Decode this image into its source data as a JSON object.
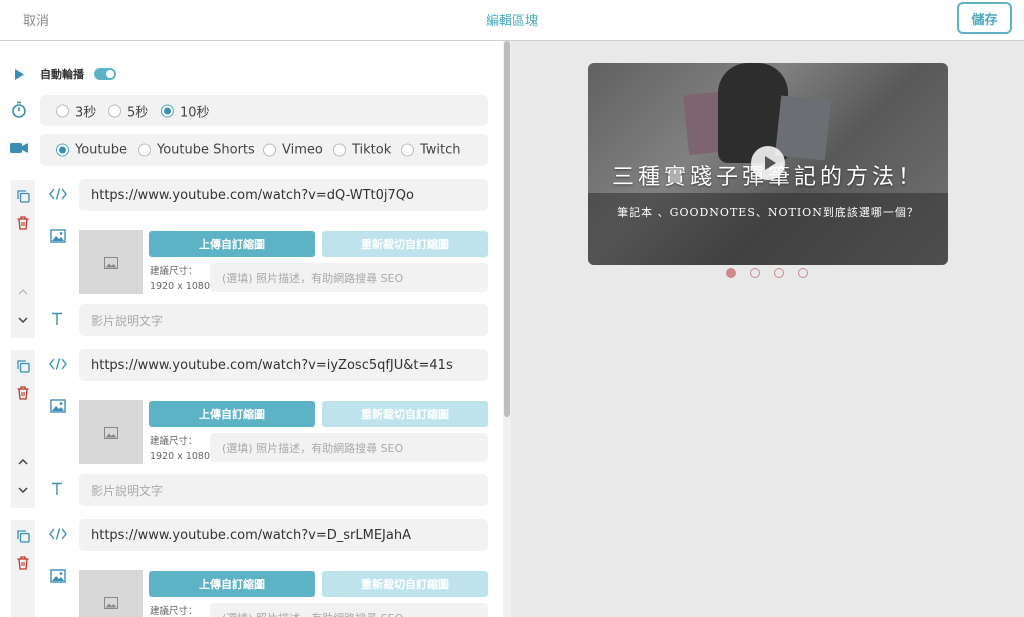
{
  "header": {
    "cancel": "取消",
    "title": "編輯區塊",
    "save": "儲存"
  },
  "autoplay": {
    "label": "自動輪播",
    "enabled": true
  },
  "interval": {
    "options": [
      "3秒",
      "5秒",
      "10秒"
    ],
    "selected": "10秒"
  },
  "platform": {
    "options": [
      "Youtube",
      "Youtube Shorts",
      "Vimeo",
      "Tiktok",
      "Twitch"
    ],
    "selected": "Youtube"
  },
  "items": [
    {
      "url": "https://www.youtube.com/watch?v=dQ-WTt0j7Qo"
    },
    {
      "url": "https://www.youtube.com/watch?v=iyZosc5qfJU&t=41s"
    },
    {
      "url": "https://www.youtube.com/watch?v=D_srLMEJahA"
    }
  ],
  "common": {
    "upload_label": "上傳自訂縮圖",
    "recrop_label": "重新裁切自訂縮圖",
    "size_label": "建議尺寸：",
    "size_value": "1920 x 1080",
    "desc_placeholder": "(選填) 照片描述，有助網路搜尋 SEO",
    "caption_placeholder": "影片說明文字"
  },
  "preview": {
    "title": "三種實踐子彈筆記的方法！",
    "subtitle": "筆記本 、GOODNOTES、NOTION到底該選哪一個？",
    "slide_count": 4,
    "active_slide": 1
  },
  "colors": {
    "accent": "#4aa9bf",
    "button": "#5db3c6",
    "button_light": "#bfe3ec",
    "delete": "#c0392b",
    "dot": "#c98b8b"
  }
}
